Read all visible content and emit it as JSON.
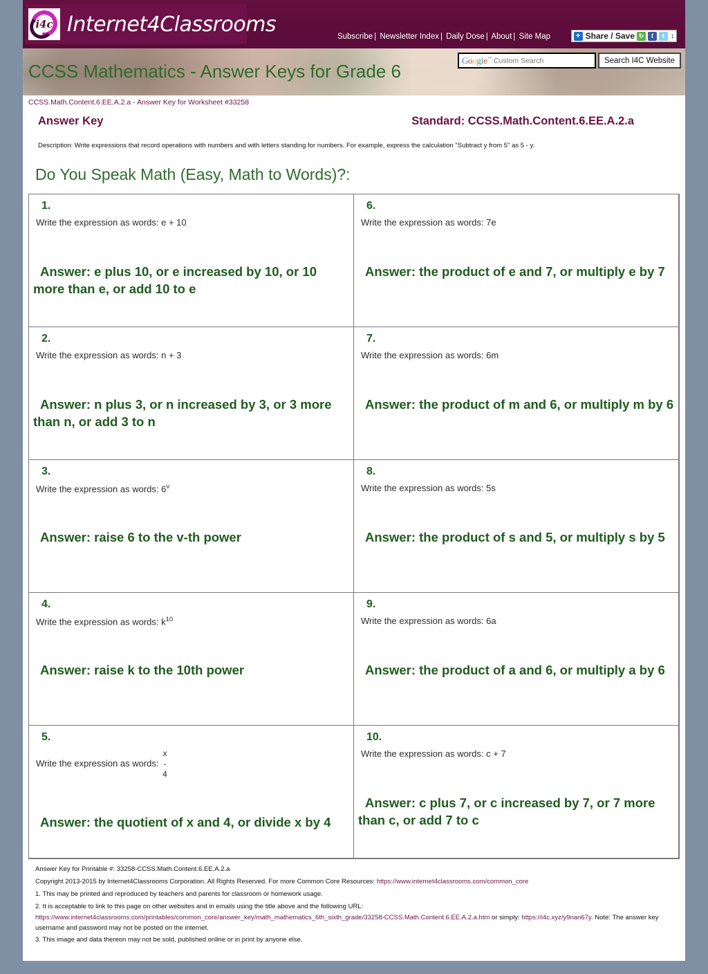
{
  "site": {
    "logo_badge": "i4c",
    "logo_text": "Internet4Classrooms",
    "nav": [
      "Subscribe",
      "Newsletter Index",
      "Daily Dose",
      "About",
      "Site Map"
    ],
    "share_label": "Share / Save",
    "share_plus": "+",
    "share_icons": [
      "addthis-icon",
      "facebook-icon",
      "twitter-icon"
    ],
    "share_arrows": "↕"
  },
  "search": {
    "google_g": "G",
    "google_o1": "o",
    "google_o2": "o",
    "google_g2": "g",
    "google_l": "l",
    "google_e": "e",
    "google_tm": "™",
    "custom_search": "Custom Search",
    "button_label": "Search I4C Website"
  },
  "banner": {
    "title": "CCSS Mathematics - Answer Keys for Grade 6"
  },
  "worksheet_ref": "CCSS.Math.Content.6.EE.A.2.a - Answer Key for Worksheet #33258",
  "answer_key": {
    "title": "Answer Key",
    "standard": "Standard: CCSS.Math.Content.6.EE.A.2.a",
    "description": "Description: Write expressions that record operations with numbers and with letters standing for numbers. For example, express the calculation \"Subtract y from 5\" as 5 - y.",
    "section_title": "Do You Speak Math (Easy, Math to Words)?:"
  },
  "questions": [
    {
      "number": "1.",
      "prompt_prefix": "Write the expression as words: ",
      "expression": "e + 10",
      "answer": "Answer: e plus 10, or e increased by 10, or 10 more than e, or add 10 to e"
    },
    {
      "number": "6.",
      "prompt_prefix": "Write the expression as words: ",
      "expression": "7e",
      "answer": "Answer: the product of e and 7, or multiply e by 7"
    },
    {
      "number": "2.",
      "prompt_prefix": "Write the expression as words: ",
      "expression": "n + 3",
      "answer": "Answer: n plus 3, or n increased by 3, or 3 more than n, or add 3 to n"
    },
    {
      "number": "7.",
      "prompt_prefix": "Write the expression as words: ",
      "expression": "6m",
      "answer": "Answer: the product of m and 6, or multiply m by 6"
    },
    {
      "number": "3.",
      "prompt_prefix": "Write the expression as words: ",
      "expression_base": "6",
      "expression_sup": "v",
      "answer": "Answer: raise 6 to the v-th power"
    },
    {
      "number": "8.",
      "prompt_prefix": "Write the expression as words: ",
      "expression": "5s",
      "answer": "Answer: the product of s and 5, or multiply s by 5"
    },
    {
      "number": "4.",
      "prompt_prefix": "Write the expression as words: ",
      "expression_base": "k",
      "expression_sup": "10",
      "answer": "Answer: raise k to the 10th power"
    },
    {
      "number": "9.",
      "prompt_prefix": "Write the expression as words: ",
      "expression": "6a",
      "answer": "Answer: the product of a and 6, or multiply a by 6"
    },
    {
      "number": "5.",
      "prompt_prefix": "Write the expression as words: ",
      "fraction_numerator": "x",
      "fraction_bar": "-",
      "fraction_denominator": "4",
      "answer": "Answer: the quotient of x and 4, or divide x by 4"
    },
    {
      "number": "10.",
      "prompt_prefix": "Write the expression as words: ",
      "expression": "c + 7",
      "answer": "Answer: c plus 7, or c increased by 7, or 7 more than c, or add 7 to c"
    }
  ],
  "footer": {
    "printable": "Answer Key for Printable #: 33258-CCSS.Math.Content.6.EE.A.2.a",
    "copyright_prefix": "Copyright 2013-2015 by Internet4Classrooms Corporation. All Rights Reserved. For more Common Core Resources: ",
    "copyright_link": "https://www.internet4classrooms.com/common_core",
    "note1": "1. This may be printed and reproduced by teachers and parents for classroom or homework usage.",
    "note2": "2. It is acceptable to link to this page on other websites and in emails using the title above and the following URL:",
    "url_long": "https://www.internet4classrooms.com/printables/common_core/answer_key/math_mathematics_6th_sixth_grade/33258-CCSS.Math.Content.6.EE.A.2.a.htm",
    "url_mid": " or simply: ",
    "url_short": "https://i4c.xyz/y9nan67y",
    "url_suffix": ". Note: The answer key username and password may not be posted on the internet.",
    "note3": "3. This image and data thereon may not be sold, published online or in print by anyone else."
  },
  "colors": {
    "maroon": "#5d0d3c",
    "green": "#1f5c1f",
    "title_green": "#2f6b2f",
    "page_bg_outer": "#7f8fa4"
  }
}
